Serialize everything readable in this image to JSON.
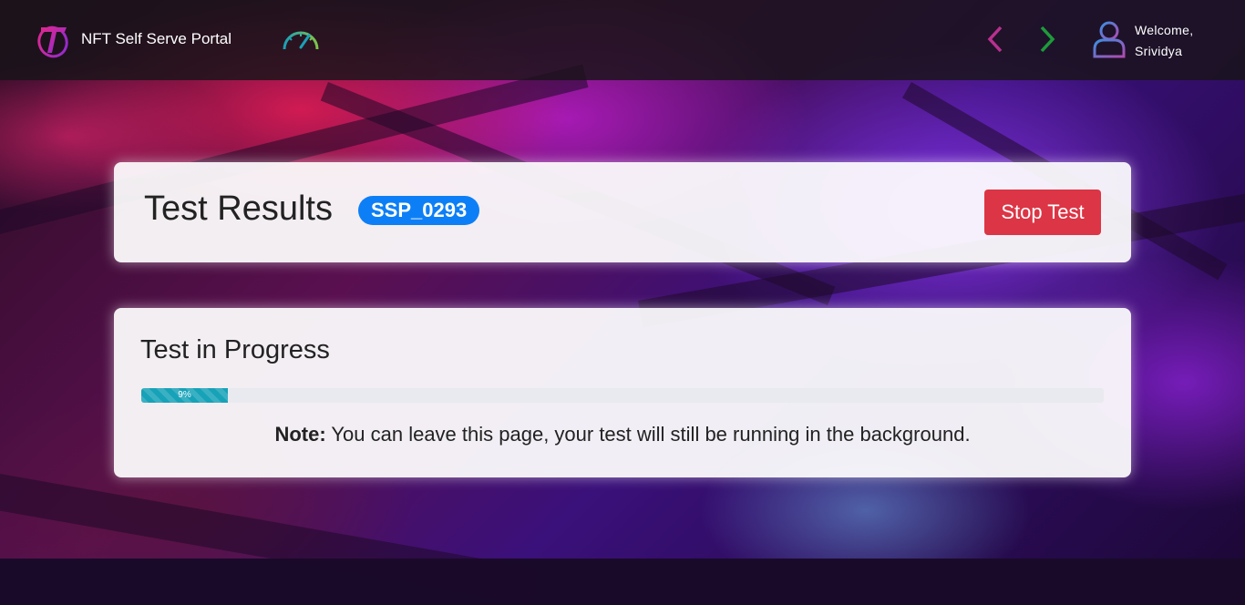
{
  "header": {
    "brand": "NFT Self Serve Portal",
    "logo_icon": "telstra-t-logo-icon",
    "dashboard_icon": "speedometer-icon",
    "back_icon": "chevron-left-icon",
    "forward_icon": "chevron-right-icon",
    "user_icon": "user-avatar-icon",
    "welcome_line1": "Welcome,",
    "welcome_line2": "Srividya"
  },
  "results": {
    "title": "Test Results",
    "test_id": "SSP_0293",
    "stop_label": "Stop Test"
  },
  "progress": {
    "title": "Test in Progress",
    "percent": 9,
    "percent_label": "9%",
    "note_label": "Note:",
    "note_text": "You can leave this page, your test will still be running in the background."
  },
  "colors": {
    "badge": "#0d7ff6",
    "stop_button": "#dc3545",
    "progress": "#17a2b8",
    "back_arrow": "#b8308f",
    "forward_arrow": "#1e9b3a"
  }
}
